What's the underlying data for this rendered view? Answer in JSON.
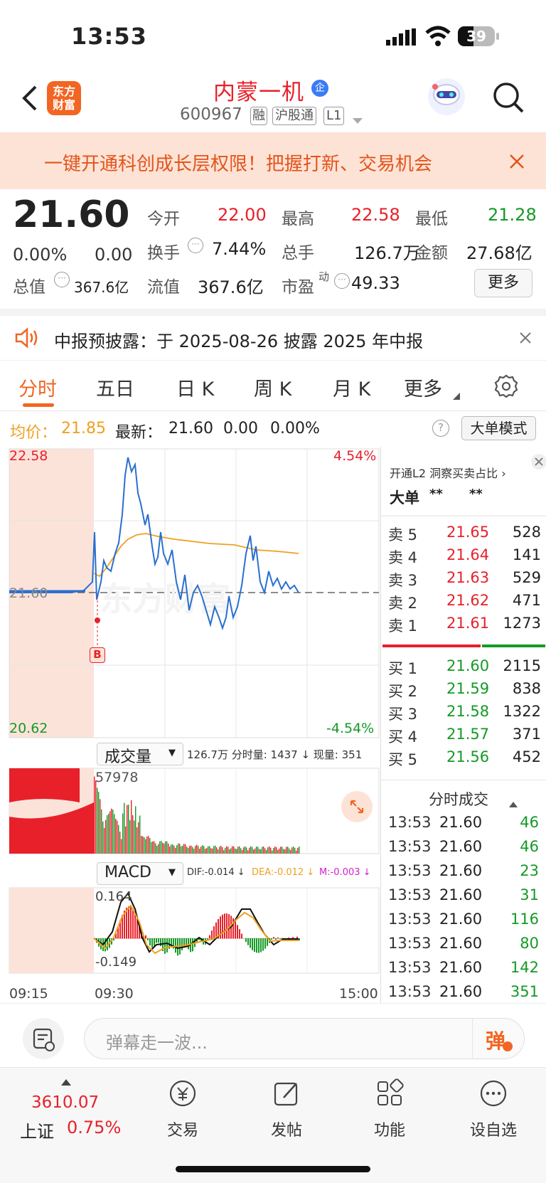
{
  "status": {
    "time": "13:53",
    "battery": "39"
  },
  "header": {
    "logo": "东方\n财富",
    "name": "内蒙一机",
    "badge": "企",
    "code": "600967",
    "tags": [
      "融",
      "沪股通",
      "L1"
    ]
  },
  "banner": {
    "text": "一键开通科创成长层权限！把握打新、交易机会"
  },
  "quote": {
    "price": "21.60",
    "chg_pct": "0.00%",
    "chg": "0.00",
    "open_label": "今开",
    "open": "22.00",
    "high_label": "最高",
    "high": "22.58",
    "low_label": "最低",
    "low": "21.28",
    "turnover_label": "换手",
    "turnover": "7.44%",
    "volume_label": "总手",
    "volume": "126.7万",
    "amount_label": "金额",
    "amount": "27.68亿",
    "mcap_label": "总值",
    "mcap": "367.6亿",
    "float_label": "流值",
    "float": "367.6亿",
    "pe_label": "市盈",
    "pe_sup": "动",
    "pe": "49.33",
    "more": "更多"
  },
  "notice": {
    "text": "中报预披露：于 2025-08-26 披露 2025 年中报"
  },
  "tabs": [
    "分时",
    "五日",
    "日 K",
    "周 K",
    "月 K",
    "更多"
  ],
  "infobar": {
    "avg_label": "均价：",
    "avg": "21.85",
    "latest_label": "最新：",
    "latest": "21.60",
    "chg": "0.00",
    "pct": "0.00%",
    "mode": "大单模式"
  },
  "chart": {
    "ymax": "22.58",
    "ymin": "20.62",
    "pmax": "4.54%",
    "pmin": "-4.54%",
    "mid": "21.60",
    "marker": "B",
    "vol_selector": "成交量",
    "vol_info": "126.7万 分时量: 1437 ↓ 现量: 351",
    "vol_max": "57978",
    "macd_selector": "MACD",
    "dif": "DIF:-0.014 ↓",
    "dea": "DEA:-0.012 ↓",
    "m": "M:-0.003 ↓",
    "macd_max": "0.164",
    "macd_min": "-0.149",
    "t0": "09:15",
    "t1": "09:30",
    "t2": "15:00",
    "watermark": "东方财富"
  },
  "book": {
    "l2": "开通L2 洞察买卖占比 ›",
    "big_label": "大单",
    "big1": "**",
    "big2": "**",
    "asks": [
      {
        "l": "卖 5",
        "p": "21.65",
        "v": "528"
      },
      {
        "l": "卖 4",
        "p": "21.64",
        "v": "141"
      },
      {
        "l": "卖 3",
        "p": "21.63",
        "v": "529"
      },
      {
        "l": "卖 2",
        "p": "21.62",
        "v": "471"
      },
      {
        "l": "卖 1",
        "p": "21.61",
        "v": "1273"
      }
    ],
    "bids": [
      {
        "l": "买 1",
        "p": "21.60",
        "v": "2115"
      },
      {
        "l": "买 2",
        "p": "21.59",
        "v": "838"
      },
      {
        "l": "买 3",
        "p": "21.58",
        "v": "1322"
      },
      {
        "l": "买 4",
        "p": "21.57",
        "v": "371"
      },
      {
        "l": "买 5",
        "p": "21.56",
        "v": "452"
      }
    ],
    "ticks_label": "分时成交",
    "ticks": [
      {
        "t": "13:53",
        "p": "21.60",
        "v": "46"
      },
      {
        "t": "13:53",
        "p": "21.60",
        "v": "46"
      },
      {
        "t": "13:53",
        "p": "21.60",
        "v": "23"
      },
      {
        "t": "13:53",
        "p": "21.60",
        "v": "31"
      },
      {
        "t": "13:53",
        "p": "21.60",
        "v": "116"
      },
      {
        "t": "13:53",
        "p": "21.60",
        "v": "80"
      },
      {
        "t": "13:53",
        "p": "21.60",
        "v": "142"
      },
      {
        "t": "13:53",
        "p": "21.60",
        "v": "351"
      }
    ]
  },
  "bottombar": {
    "placeholder": "弹幕走一波...",
    "danmu": "弹"
  },
  "nav": {
    "index_value": "3610.07",
    "index_name": "上证",
    "index_pct": "0.75%",
    "items": [
      "交易",
      "发帖",
      "功能",
      "设自选"
    ]
  },
  "colors": {
    "red": "#e8202a",
    "green": "#149a25",
    "avg": "#f0a020",
    "price_line": "#2a6fcf"
  }
}
